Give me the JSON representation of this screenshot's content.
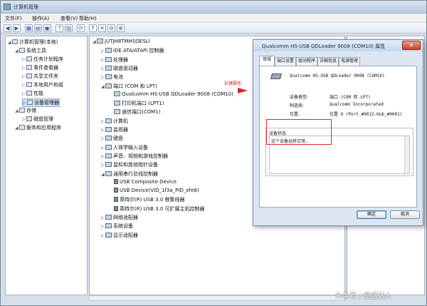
{
  "window": {
    "title": "计算机管理",
    "menus": [
      "文件(F)",
      "操作(A)",
      "查看(V)",
      "帮助(H)"
    ]
  },
  "left_tree": [
    {
      "label": "计算机管理(本地)",
      "indent": 0
    },
    {
      "label": "系统工具",
      "indent": 1
    },
    {
      "label": "任务计划程序",
      "indent": 2
    },
    {
      "label": "事件查看器",
      "indent": 2
    },
    {
      "label": "共享文件夹",
      "indent": 2
    },
    {
      "label": "本地用户和组",
      "indent": 2
    },
    {
      "label": "性能",
      "indent": 2
    },
    {
      "label": "设备管理器",
      "indent": 2,
      "selected": true
    },
    {
      "label": "存储",
      "indent": 1
    },
    {
      "label": "磁盘管理",
      "indent": 2
    },
    {
      "label": "服务和应用程序",
      "indent": 1
    }
  ],
  "device_tree": [
    {
      "label": "JUTJH8TMHSOESLI",
      "indent": 0
    },
    {
      "label": "IDE ATA/ATAPI 控制器",
      "indent": 1
    },
    {
      "label": "处理器",
      "indent": 1
    },
    {
      "label": "磁盘驱动器",
      "indent": 1
    },
    {
      "label": "电池",
      "indent": 1
    },
    {
      "label": "端口 (COM 和 LPT)",
      "indent": 1
    },
    {
      "label": "Qualcomm HS-USB QDLoader 9008 (COM10)",
      "indent": 2
    },
    {
      "label": "打印机端口 (LPT1)",
      "indent": 2
    },
    {
      "label": "通信端口(COM1)",
      "indent": 2
    },
    {
      "label": "计算机",
      "indent": 1
    },
    {
      "label": "监视器",
      "indent": 1
    },
    {
      "label": "键盘",
      "indent": 1
    },
    {
      "label": "人体学输入设备",
      "indent": 1
    },
    {
      "label": "声音、视频和游戏控制器",
      "indent": 1
    },
    {
      "label": "鼠标和其他指针设备",
      "indent": 1
    },
    {
      "label": "通用串行总线控制器",
      "indent": 1
    },
    {
      "label": "USB Composite Device",
      "indent": 2
    },
    {
      "label": "USB Device(VID_1f3a_PID_efe8)",
      "indent": 2,
      "warning": true
    },
    {
      "label": "英特尔(R) USB 3.0 根集线器",
      "indent": 2
    },
    {
      "label": "英特尔(R) USB 3.0 可扩展主机控制器",
      "indent": 2
    },
    {
      "label": "网络适配器",
      "indent": 1
    },
    {
      "label": "系统设备",
      "indent": 1
    },
    {
      "label": "显示适配器",
      "indent": 1
    }
  ],
  "annotation": "右键属性",
  "dialog": {
    "title": "Qualcomm HS-USB QDLoader 9008 (COM10) 属性",
    "close_label": "✕",
    "tabs": [
      "常规",
      "端口设置",
      "驱动程序",
      "详细信息",
      "电源管理"
    ],
    "device_name": "Qualcomm HS-USB QDLoader 9008 (COM10)",
    "props": [
      {
        "label": "设备类型:",
        "value": "端口 (COM 和 LPT)"
      },
      {
        "label": "制造商:",
        "value": "Qualcomm Incorporated"
      },
      {
        "label": "位置:",
        "value": "位置 0 (Port_#0012.Hub_#0001)"
      }
    ],
    "status_label": "设备状态",
    "status_text": "这个设备运转正常。",
    "ok_label": "确定",
    "cancel_label": "取消"
  },
  "watermark": "头条号 / 鼎盛达人"
}
